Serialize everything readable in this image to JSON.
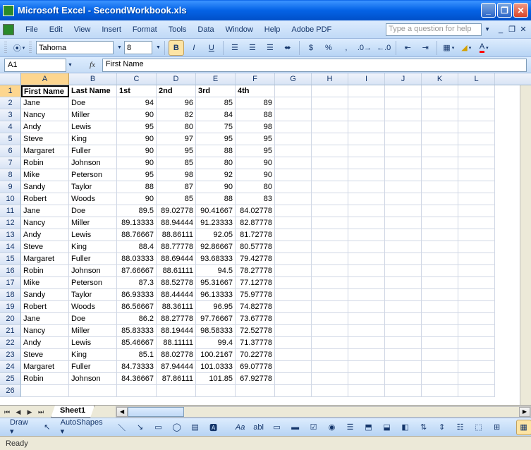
{
  "title": "Microsoft Excel - SecondWorkbook.xls",
  "menus": [
    "File",
    "Edit",
    "View",
    "Insert",
    "Format",
    "Tools",
    "Data",
    "Window",
    "Help",
    "Adobe PDF"
  ],
  "help_placeholder": "Type a question for help",
  "font": {
    "name": "Tahoma",
    "size": "8"
  },
  "namebox": "A1",
  "formula": "First Name",
  "columns": [
    "A",
    "B",
    "C",
    "D",
    "E",
    "F",
    "G",
    "H",
    "I",
    "J",
    "K",
    "L"
  ],
  "headers": [
    "First Name",
    "Last Name",
    "1st",
    "2nd",
    "3rd",
    "4th"
  ],
  "rows": [
    [
      "Jane",
      "Doe",
      "94",
      "96",
      "85",
      "89"
    ],
    [
      "Nancy",
      "Miller",
      "90",
      "82",
      "84",
      "88"
    ],
    [
      "Andy",
      "Lewis",
      "95",
      "80",
      "75",
      "98"
    ],
    [
      "Steve",
      "King",
      "90",
      "97",
      "95",
      "95"
    ],
    [
      "Margaret",
      "Fuller",
      "90",
      "95",
      "88",
      "95"
    ],
    [
      "Robin",
      "Johnson",
      "90",
      "85",
      "80",
      "90"
    ],
    [
      "Mike",
      "Peterson",
      "95",
      "98",
      "92",
      "90"
    ],
    [
      "Sandy",
      "Taylor",
      "88",
      "87",
      "90",
      "80"
    ],
    [
      "Robert",
      "Woods",
      "90",
      "85",
      "88",
      "83"
    ],
    [
      "Jane",
      "Doe",
      "89.5",
      "89.02778",
      "90.41667",
      "84.02778"
    ],
    [
      "Nancy",
      "Miller",
      "89.13333",
      "88.94444",
      "91.23333",
      "82.87778"
    ],
    [
      "Andy",
      "Lewis",
      "88.76667",
      "88.86111",
      "92.05",
      "81.72778"
    ],
    [
      "Steve",
      "King",
      "88.4",
      "88.77778",
      "92.86667",
      "80.57778"
    ],
    [
      "Margaret",
      "Fuller",
      "88.03333",
      "88.69444",
      "93.68333",
      "79.42778"
    ],
    [
      "Robin",
      "Johnson",
      "87.66667",
      "88.61111",
      "94.5",
      "78.27778"
    ],
    [
      "Mike",
      "Peterson",
      "87.3",
      "88.52778",
      "95.31667",
      "77.12778"
    ],
    [
      "Sandy",
      "Taylor",
      "86.93333",
      "88.44444",
      "96.13333",
      "75.97778"
    ],
    [
      "Robert",
      "Woods",
      "86.56667",
      "88.36111",
      "96.95",
      "74.82778"
    ],
    [
      "Jane",
      "Doe",
      "86.2",
      "88.27778",
      "97.76667",
      "73.67778"
    ],
    [
      "Nancy",
      "Miller",
      "85.83333",
      "88.19444",
      "98.58333",
      "72.52778"
    ],
    [
      "Andy",
      "Lewis",
      "85.46667",
      "88.11111",
      "99.4",
      "71.37778"
    ],
    [
      "Steve",
      "King",
      "85.1",
      "88.02778",
      "100.2167",
      "70.22778"
    ],
    [
      "Margaret",
      "Fuller",
      "84.73333",
      "87.94444",
      "101.0333",
      "69.07778"
    ],
    [
      "Robin",
      "Johnson",
      "84.36667",
      "87.86111",
      "101.85",
      "67.92778"
    ]
  ],
  "sheet": "Sheet1",
  "status": "Ready",
  "draw": {
    "label": "Draw",
    "autoshapes": "AutoShapes"
  }
}
